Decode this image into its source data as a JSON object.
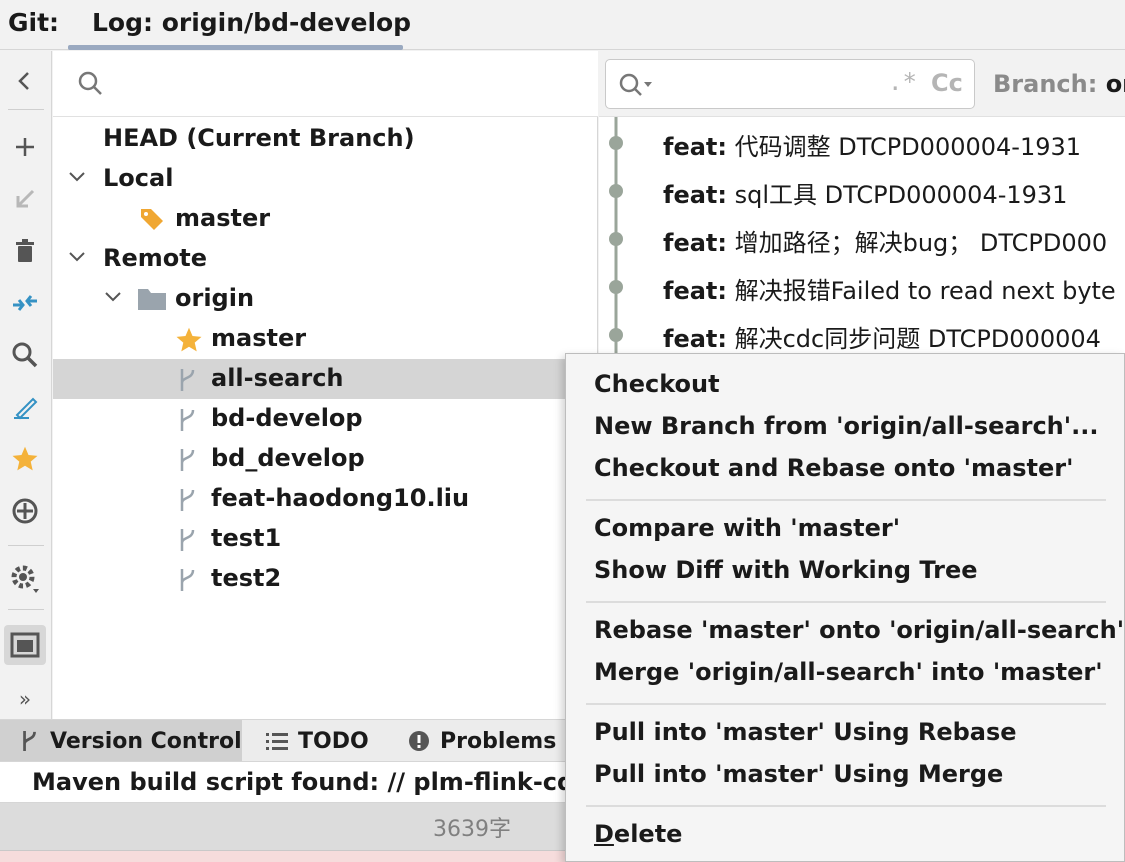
{
  "tabbar": {
    "tool_window_label": "Git:",
    "active_tab": "Log: origin/bd-develop"
  },
  "toolbar": {
    "icons": [
      "chevron-left-icon",
      "plus-icon",
      "update-icon",
      "trash-icon",
      "compare-icon",
      "search-icon",
      "edit-icon",
      "star-icon",
      "target-icon",
      "settings-icon",
      "layout-icon",
      "more-icon"
    ],
    "more_label": "»"
  },
  "branches": {
    "search_placeholder": "",
    "head": "HEAD (Current Branch)",
    "local_label": "Local",
    "local_branches": [
      "master"
    ],
    "remote_label": "Remote",
    "remote_name": "origin",
    "remote_branches": [
      "master",
      "all-search",
      "bd-develop",
      "bd_develop",
      "feat-haodong10.liu",
      "test1",
      "test2"
    ],
    "selected": "all-search"
  },
  "log": {
    "search_placeholder": "",
    "regex_label": ".*",
    "case_label": "Cc",
    "branch_filter_label": "Branch: ",
    "branch_filter_value": "ori",
    "commits": [
      {
        "type": "feat:",
        "message": " 代码调整 DTCPD000004-1931"
      },
      {
        "type": "feat:",
        "message": " sql工具 DTCPD000004-1931"
      },
      {
        "type": "feat:",
        "message": " 增加路径；解决bug； DTCPD000"
      },
      {
        "type": "feat:",
        "message": " 解决报错Failed to read next byte"
      },
      {
        "type": "feat:",
        "message": " 解决cdc同步问题 DTCPD000004"
      }
    ]
  },
  "bottom_tabs": {
    "version_control": "Version Control",
    "todo": "TODO",
    "problems": "Problems"
  },
  "status": {
    "message": "Maven build script found: // plm-flink-cdc /",
    "char_count": "3639字"
  },
  "context_menu": {
    "items": [
      "Checkout",
      "New Branch from 'origin/all-search'...",
      "Checkout and Rebase onto 'master'",
      "Compare with 'master'",
      "Show Diff with Working Tree",
      "Rebase 'master' onto 'origin/all-search'",
      "Merge 'origin/all-search' into 'master'",
      "Pull into 'master' Using Rebase",
      "Pull into 'master' Using Merge"
    ],
    "delete_mnemonic": "D",
    "delete_rest": "elete"
  },
  "colors": {
    "accent_blue": "#3592c4",
    "star_yellow": "#f4b23a",
    "tag_orange": "#f0a732",
    "graph_gray": "#9aa59a"
  }
}
